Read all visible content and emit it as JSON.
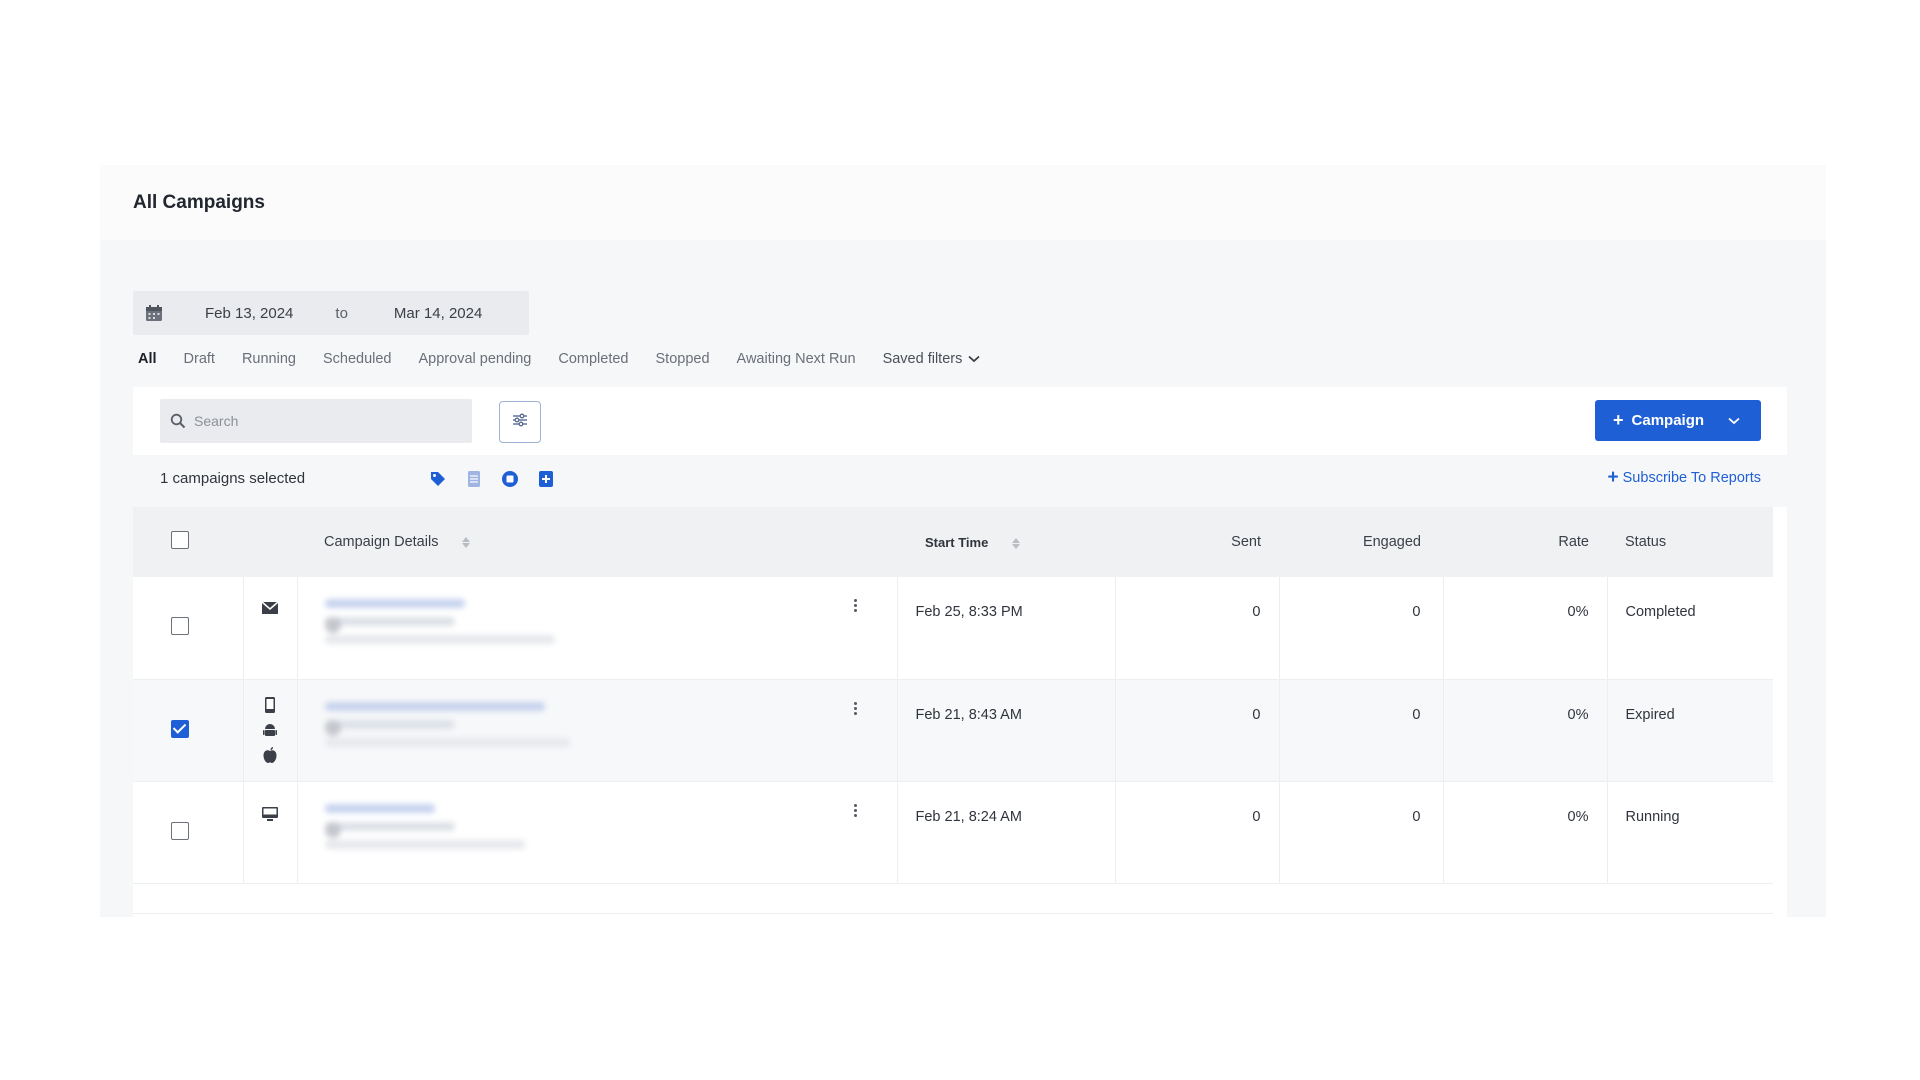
{
  "page": {
    "title": "All Campaigns"
  },
  "date_range": {
    "start": "Feb 13, 2024",
    "separator": "to",
    "end": "Mar 14, 2024"
  },
  "tabs": [
    {
      "label": "All",
      "active": true
    },
    {
      "label": "Draft"
    },
    {
      "label": "Running"
    },
    {
      "label": "Scheduled"
    },
    {
      "label": "Approval pending"
    },
    {
      "label": "Completed"
    },
    {
      "label": "Stopped"
    },
    {
      "label": "Awaiting Next Run"
    }
  ],
  "saved_filters": {
    "label": "Saved filters"
  },
  "toolbar": {
    "search_placeholder": "Search",
    "campaign_button_label": "Campaign",
    "selected_text": "1 campaigns selected",
    "subscribe_label": "Subscribe To Reports"
  },
  "table": {
    "headers": {
      "details": "Campaign Details",
      "start_time": "Start Time",
      "sent": "Sent",
      "engaged": "Engaged",
      "rate": "Rate",
      "status": "Status"
    },
    "rows": [
      {
        "channel_icons": [
          "email-icon"
        ],
        "checked": false,
        "start_time": "Feb 25, 8:33 PM",
        "sent": "0",
        "engaged": "0",
        "rate": "0%",
        "status": "Completed"
      },
      {
        "channel_icons": [
          "mobile-icon",
          "android-icon",
          "apple-icon"
        ],
        "checked": true,
        "start_time": "Feb 21, 8:43 AM",
        "sent": "0",
        "engaged": "0",
        "rate": "0%",
        "status": "Expired"
      },
      {
        "channel_icons": [
          "desktop-icon"
        ],
        "checked": false,
        "start_time": "Feb 21, 8:24 AM",
        "sent": "0",
        "engaged": "0",
        "rate": "0%",
        "status": "Running"
      }
    ]
  },
  "colors": {
    "accent": "#1f5fd6",
    "header_bg": "#f0f1f3",
    "page_bg": "#f6f7f9"
  }
}
